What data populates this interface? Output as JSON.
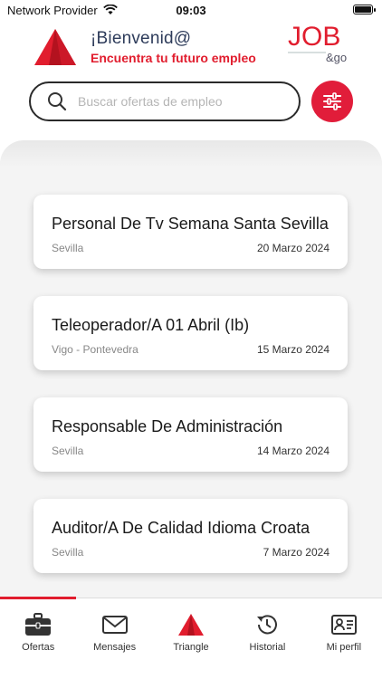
{
  "status_bar": {
    "carrier": "Network Provider",
    "time": "09:03"
  },
  "header": {
    "welcome_title": "¡Bienvenid@",
    "welcome_subtitle": "Encuentra tu futuro empleo",
    "logo_text": "JOB",
    "logo_sub": "&go"
  },
  "search": {
    "placeholder": "Buscar ofertas de empleo",
    "value": ""
  },
  "colors": {
    "accent": "#e11d2e",
    "navy": "#2d3b5a"
  },
  "jobs": [
    {
      "title": "Personal De Tv Semana Santa Sevilla",
      "location": "Sevilla",
      "date": "20 Marzo 2024"
    },
    {
      "title": "Teleoperador/A  01 Abril (Ib)",
      "location": "Vigo - Pontevedra",
      "date": "15 Marzo 2024"
    },
    {
      "title": "Responsable De Administración",
      "location": "Sevilla",
      "date": "14 Marzo 2024"
    },
    {
      "title": "Auditor/A De Calidad Idioma Croata",
      "location": "Sevilla",
      "date": "7 Marzo 2024"
    }
  ],
  "nav": [
    {
      "label": "Ofertas",
      "icon": "briefcase-icon"
    },
    {
      "label": "Mensajes",
      "icon": "mail-icon"
    },
    {
      "label": "Triangle",
      "icon": "triangle-icon"
    },
    {
      "label": "Historial",
      "icon": "history-icon"
    },
    {
      "label": "Mi perfil",
      "icon": "profile-card-icon"
    }
  ]
}
